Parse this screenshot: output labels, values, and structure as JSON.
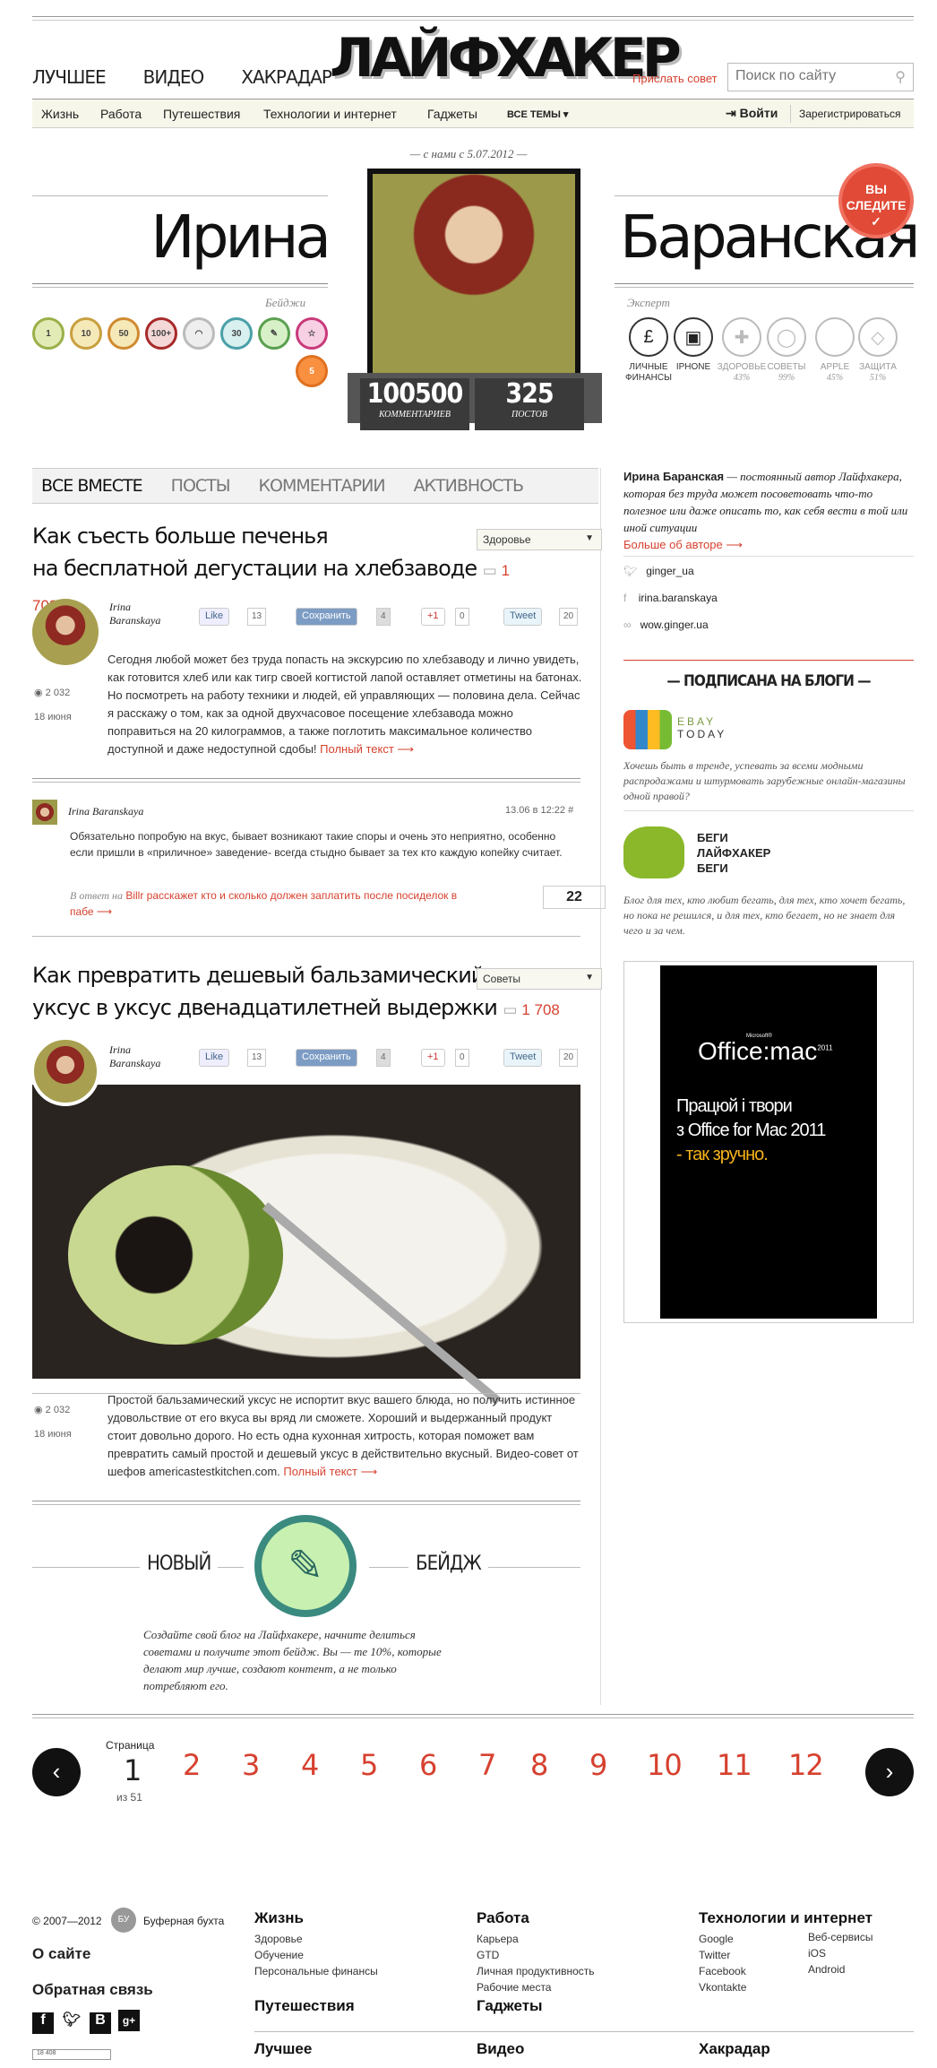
{
  "header": {
    "nav": [
      "ЛУЧШЕЕ",
      "ВИДЕО",
      "ХАКРАДАР"
    ],
    "logo": "ЛАЙФХАКЕР",
    "submit": "Прислать совет",
    "search_placeholder": "Поиск по сайту"
  },
  "categories": {
    "items": [
      "Жизнь",
      "Работа",
      "Путешествия",
      "Технологии и интернет",
      "Гаджеты"
    ],
    "all": "ВСЕ ТЕМЫ",
    "login": "Войти",
    "register": "Зарегистрироваться"
  },
  "profile": {
    "since": "— с нами с 5.07.2012 —",
    "first": "Ирина",
    "last": "Баранская",
    "badges_label": "Бейджи",
    "expert_label": "Эксперт",
    "following": "ВЫ СЛЕДИТЕ",
    "comments_count": "100500",
    "comments_label": "КОММЕНТАРИЕВ",
    "posts_count": "325",
    "posts_label": "ПОСТОВ",
    "badges": [
      "1",
      "10",
      "50",
      "100+",
      "",
      "30",
      "",
      "",
      "5"
    ],
    "expert": [
      {
        "icon": "£",
        "name": "ЛИЧНЫЕ ФИНАНСЫ",
        "pct": ""
      },
      {
        "icon": "▣",
        "name": "IPHONE",
        "pct": ""
      },
      {
        "icon": "✚",
        "name": "ЗДОРОВЬЕ",
        "pct": "43%"
      },
      {
        "icon": "◯",
        "name": "СОВЕТЫ",
        "pct": "99%"
      },
      {
        "icon": "",
        "name": "APPLE",
        "pct": "45%"
      },
      {
        "icon": "◇",
        "name": "ЗАЩИТА",
        "pct": "51%"
      }
    ]
  },
  "tabs": [
    "ВСЕ ВМЕСТЕ",
    "ПОСТЫ",
    "КОММЕНТАРИИ",
    "АКТИВНОСТЬ"
  ],
  "post1": {
    "title1": "Как съесть больше печенья",
    "title2": "на бесплатной дегустации на хлебзаводе",
    "comments": "1 708",
    "category": "Здоровье",
    "author1": "Irina",
    "author2": "Baranskaya",
    "like": "Like",
    "like_n": "13",
    "save": "Сохранить",
    "save_n": "4",
    "plus": "+1",
    "plus_n": "0",
    "tweet": "Tweet",
    "tweet_n": "20",
    "views": "2 032",
    "date": "18 июня",
    "text": "Сегодня любой может без труда попасть на экскурсию по хлебзаводу и лично увидеть, как готовится хлеб или как тигр своей когтистой лапой оставляет отметины на батонах. Но посмотреть на работу техники и людей, ей управляющих — половина дела. Сейчас я расскажу о том, как за одной двухчасовое посещение хлебзавода можно поправиться на 20 килограммов, а также поглотить максимальное количество доступной и даже недоступной сдобы!",
    "more": "Полный текст ⟶"
  },
  "comment": {
    "author": "Irina Baranskaya",
    "date": "13.06 в 12:22 #",
    "text": "Обязательно попробую на вкус, бывает возникают такие споры и очень это неприятно, особенно если пришли в «приличное» заведение- всегда стыдно бывает за тех кто каждую копейку считает.",
    "reply_prefix": "В ответ на",
    "reply_link": "Billr расскажет кто и сколько должен заплатить после посиделок в пабе ⟶",
    "votes": "22"
  },
  "post2": {
    "title1": "Как превратить дешевый бальзамический",
    "title2": "уксус в уксус двенадцатилетней выдержки",
    "comments": "1 708",
    "category": "Советы",
    "author1": "Irina",
    "author2": "Baranskaya",
    "like": "Like",
    "like_n": "13",
    "save": "Сохранить",
    "save_n": "4",
    "plus": "+1",
    "plus_n": "0",
    "tweet": "Tweet",
    "tweet_n": "20",
    "views": "2 032",
    "date": "18 июня",
    "text": "Простой бальзамический уксус не испортит вкус вашего блюда, но получить истинное удовольствие от его вкуса вы вряд ли сможете. Хороший и выдержанный продукт стоит довольно дорого. Но есть одна кухонная хитрость, которая поможет вам превратить самый простой и дешевый уксус в действительно вкусный. Видео-совет от шефов americastestkitchen.com.",
    "more": "Полный текст ⟶"
  },
  "newbadge": {
    "left": "НОВЫЙ",
    "right": "БЕЙДЖ",
    "text": "Создайте свой блог на Лайфхакере, начните делиться советами и получите этот бейдж. Вы — те 10%, которые делают мир лучше, создают контент, а не только потребляют его."
  },
  "sidebar": {
    "bio_name": "Ирина Баранская",
    "bio": " — постоянный автор Лайфхакера, которая без труда может посоветовать что-то полезное или даже описать то, как себя вести в той или иной ситуации",
    "more": "Больше об авторе ⟶",
    "links": [
      "ginger_ua",
      "irina.baranskaya",
      "wow.ginger.ua"
    ],
    "subs_title": "— ПОДПИСАНА НА БЛОГИ —",
    "blog1": {
      "logo1": "EBAY",
      "logo2": "TODAY",
      "text": "Хочешь быть в тренде, успевать за всеми модными распродажами и штурмовать зарубежные онлайн-магазины одной правой?"
    },
    "blog2": {
      "t1": "БЕГИ",
      "t2": "ЛАЙФХАКЕР",
      "t3": "БЕГИ",
      "text": "Блог для тех, кто любит бегать, для тех, кто хочет бегать, но пока не решился, и для тех, кто бегает, но не знает для чего и за чем."
    },
    "ad": {
      "brand": "Office:mac",
      "year": "2011",
      "small": "Microsoft®",
      "l1": "Працюй і твори",
      "l2": "з Office for Mac 2011",
      "l3": "- так зручно."
    }
  },
  "pager": {
    "label": "Страница",
    "current": "1",
    "total": "из 51",
    "pages": [
      "2",
      "3",
      "4",
      "5",
      "6",
      "7",
      "8",
      "9",
      "10",
      "11",
      "12"
    ]
  },
  "footer": {
    "copy": "© 2007—2012",
    "buffer": "Буферная бухта",
    "about": "О сайте",
    "feedback": "Обратная связь",
    "cols": [
      {
        "h": "Жизнь",
        "items": [
          "Здоровье",
          "Обучение",
          "Персональные финансы"
        ]
      },
      {
        "h": "Работа",
        "items": [
          "Карьера",
          "GTD",
          "Личная продуктивность",
          "Рабочие места"
        ]
      },
      {
        "h": "Технологии и интернет",
        "items": [
          "Google",
          "Twitter",
          "Facebook",
          "Vkontakte"
        ]
      },
      {
        "h": "",
        "items": [
          "Веб-сервисы",
          "iOS",
          "Android"
        ]
      }
    ],
    "row2": [
      "Путешествия",
      "Гаджеты"
    ],
    "row3": [
      "Лучшее",
      "Видео",
      "Хакрадар"
    ],
    "counter": "18 408"
  }
}
